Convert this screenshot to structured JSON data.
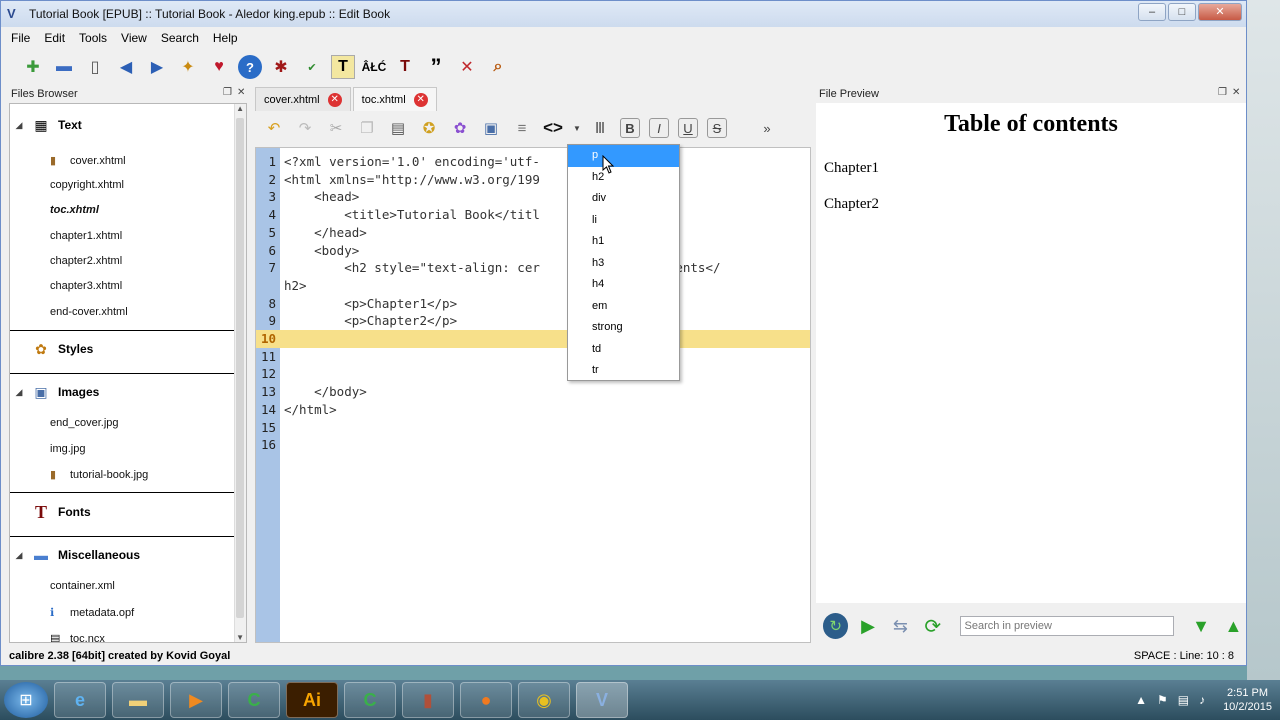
{
  "window": {
    "title": "Tutorial Book [EPUB] :: Tutorial Book - Aledor king.epub :: Edit Book",
    "controls": [
      "–",
      "□",
      "✕"
    ]
  },
  "menu": [
    "File",
    "Edit",
    "Tools",
    "View",
    "Search",
    "Help"
  ],
  "files_browser": {
    "title": "Files Browser",
    "categories": {
      "text": "Text",
      "styles": "Styles",
      "images": "Images",
      "fonts": "Fonts",
      "misc": "Miscellaneous"
    },
    "text_files": [
      "cover.xhtml",
      "copyright.xhtml",
      "toc.xhtml",
      "chapter1.xhtml",
      "chapter2.xhtml",
      "chapter3.xhtml",
      "end-cover.xhtml"
    ],
    "image_files": [
      "end_cover.jpg",
      "img.jpg",
      "tutorial-book.jpg"
    ],
    "misc_files": [
      "container.xml",
      "metadata.opf",
      "toc.ncx"
    ]
  },
  "tabs": [
    {
      "label": "cover.xhtml",
      "active": false
    },
    {
      "label": "toc.xhtml",
      "active": true
    }
  ],
  "editor": {
    "current_line": 10,
    "lines": [
      "<?xml version='1.0' encoding='utf-",
      "<html xmlns=\"http://www.w3.org/199",
      "    <head>",
      "        <title>Tutorial Book</titl",
      "    </head>",
      "    <body>",
      "        <h2 style=\"text-align: cer            f contents</",
      "h2>",
      "        <p>Chapter1</p>",
      "        <p>Chapter2</p>",
      "",
      "",
      "",
      "    </body>",
      "</html>",
      ""
    ],
    "line_numbers": [
      "1",
      "2",
      "3",
      "4",
      "5",
      "6",
      "7",
      "",
      "8",
      "9",
      "10",
      "11",
      "12",
      "13",
      "14",
      "15",
      "16"
    ]
  },
  "tag_dropdown": {
    "items": [
      "p",
      "h2",
      "div",
      "li",
      "h1",
      "h3",
      "h4",
      "em",
      "strong",
      "td",
      "tr"
    ],
    "selected": "p"
  },
  "preview": {
    "title": "File Preview",
    "heading": "Table of contents",
    "paragraphs": [
      "Chapter1",
      "Chapter2"
    ],
    "search_placeholder": "Search in preview"
  },
  "status": {
    "left": "calibre 2.38 [64bit] created by Kovid Goyal",
    "right": "SPACE : Line: 10 : 8"
  },
  "taskbar": {
    "time": "2:51 PM",
    "date": "10/2/2015"
  },
  "colors": {
    "gutter": "#a9c4e6",
    "current_line": "#f7e08a",
    "dropdown_selection": "#3399ff",
    "tab_close": "#dd3333"
  }
}
